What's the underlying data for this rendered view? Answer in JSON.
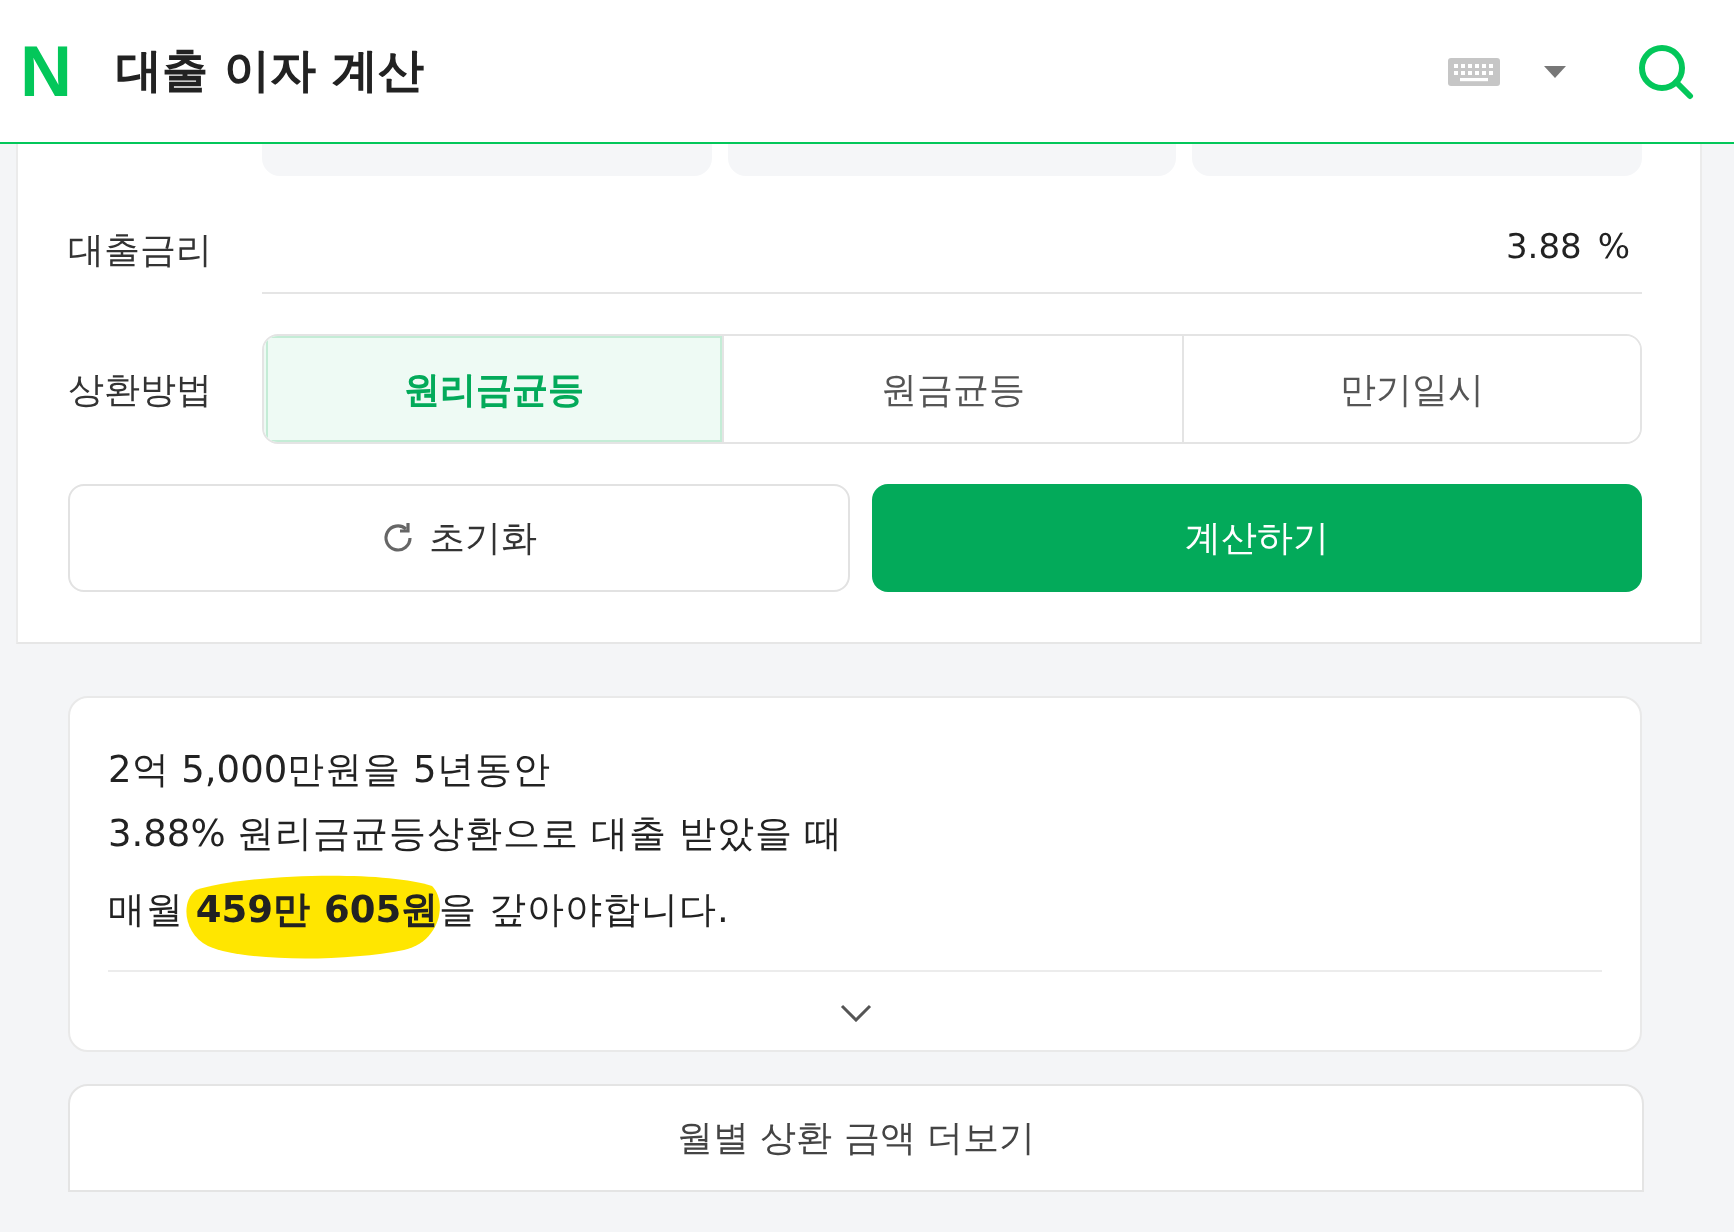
{
  "header": {
    "logo": "N",
    "title": "대출 이자 계산"
  },
  "rate": {
    "label": "대출금리",
    "value": "3.88",
    "unit": "%"
  },
  "repayment": {
    "label": "상환방법",
    "options": [
      {
        "label": "원리금균등",
        "selected": true
      },
      {
        "label": "원금균등",
        "selected": false
      },
      {
        "label": "만기일시",
        "selected": false
      }
    ]
  },
  "buttons": {
    "reset": "초기화",
    "calculate": "계산하기"
  },
  "result": {
    "lines": [
      "2억 5,000만원을 5년동안",
      "3.88% 원리금균등상환으로 대출 받았을 때",
      "매월 **459만 605원**을 갚아야합니다."
    ],
    "expanded": false
  },
  "more_button": "월별 상환 금액 더보기"
}
